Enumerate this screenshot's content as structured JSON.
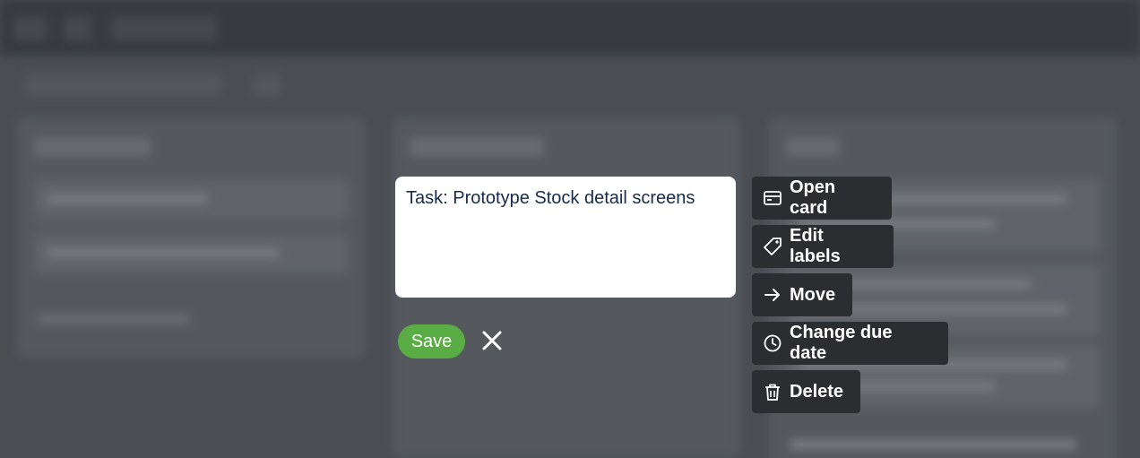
{
  "editor": {
    "text": "Task: Prototype Stock detail screens",
    "save_label": "Save"
  },
  "actions": [
    {
      "label": "Open card",
      "icon": "card-icon"
    },
    {
      "label": "Edit labels",
      "icon": "tag-icon"
    },
    {
      "label": "Move",
      "icon": "arrow-right-icon"
    },
    {
      "label": "Change due date",
      "icon": "clock-icon"
    },
    {
      "label": "Delete",
      "icon": "trash-icon"
    }
  ],
  "colors": {
    "save": "#5aac44",
    "action_bg": "#2b2d30",
    "overlay": "#5c6166"
  }
}
